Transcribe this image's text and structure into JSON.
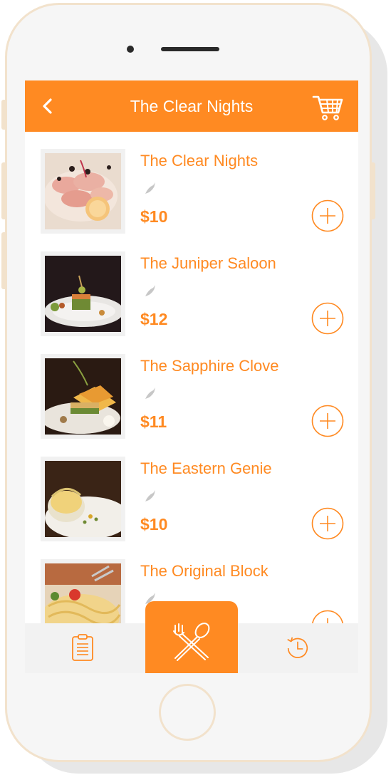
{
  "header": {
    "title": "The Clear Nights",
    "back_icon": "chevron-left-icon",
    "cart_icon": "cart-icon"
  },
  "colors": {
    "accent": "#ff8a22",
    "tabbar": "#f2f2f2"
  },
  "menu_items": [
    {
      "name": "The Clear Nights",
      "price": "$10"
    },
    {
      "name": "The Juniper Saloon",
      "price": "$12"
    },
    {
      "name": "The Sapphire Clove",
      "price": "$11"
    },
    {
      "name": "The Eastern Genie",
      "price": "$10"
    },
    {
      "name": "The Original Block",
      "price": ""
    }
  ],
  "tabbar": {
    "tabs": [
      {
        "icon": "clipboard-icon"
      },
      {
        "icon": "fork-spoon-icon",
        "active": true
      },
      {
        "icon": "history-clock-icon"
      }
    ]
  }
}
